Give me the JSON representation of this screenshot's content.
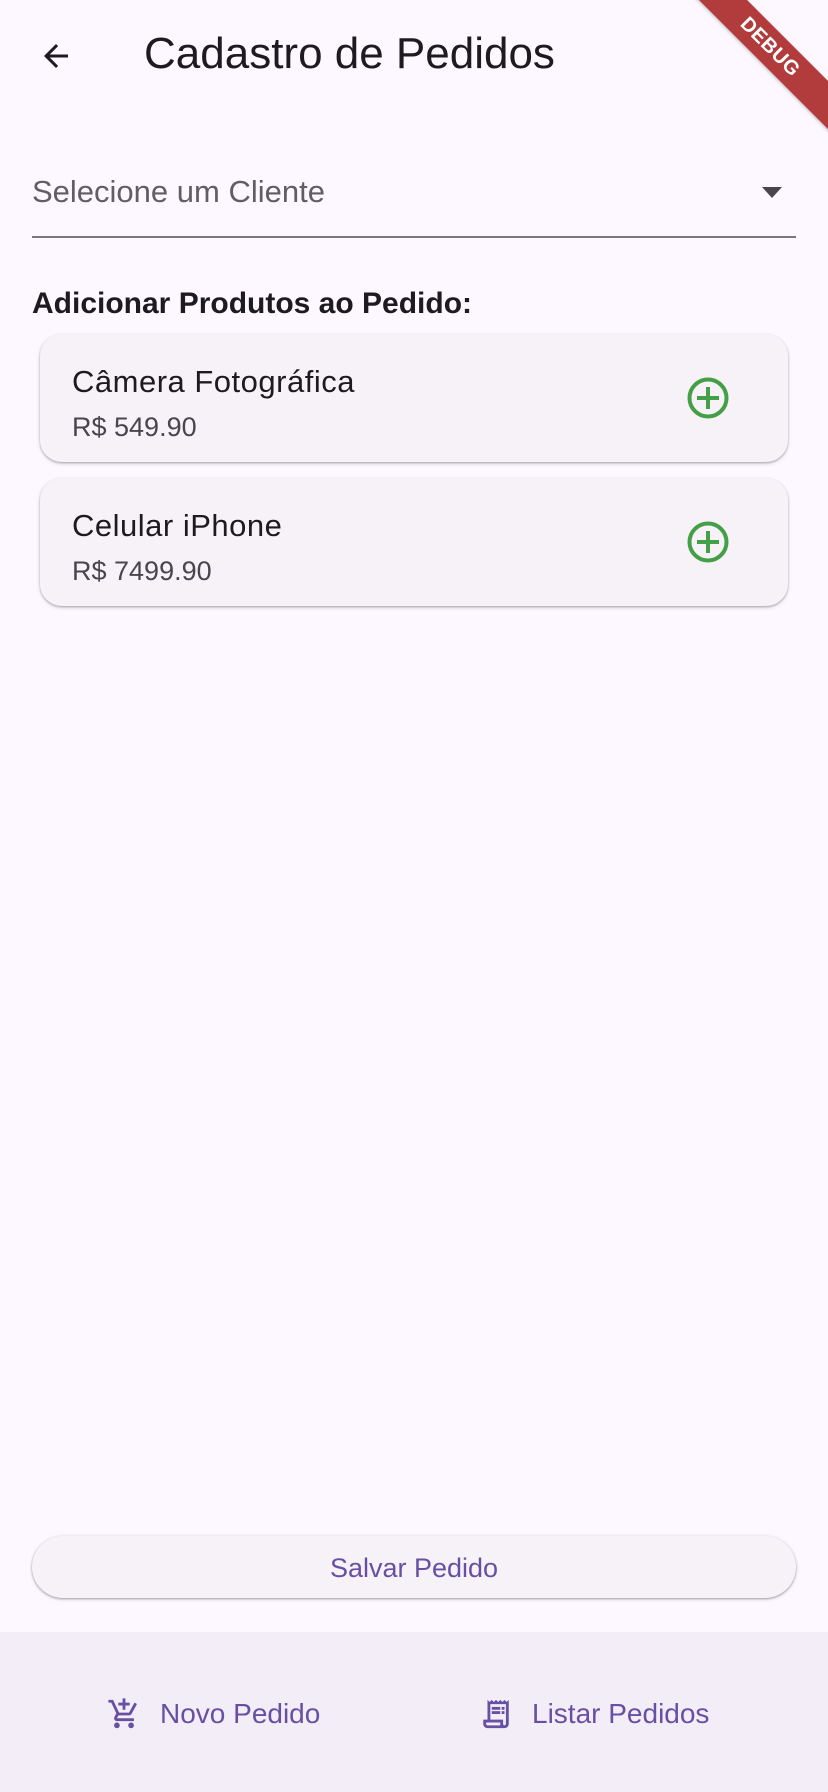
{
  "app_bar": {
    "title": "Cadastro de Pedidos",
    "back_icon": "arrow-back-icon"
  },
  "debug_banner": {
    "label": "DEBUG",
    "color": "#b23b3b"
  },
  "client_select": {
    "placeholder": "Selecione um Cliente",
    "icon": "arrow-drop-down-icon"
  },
  "products_section": {
    "label": "Adicionar Produtos ao Pedido:",
    "items": [
      {
        "name": "Câmera Fotográfica",
        "price": "R$ 549.90",
        "icon": "add-circle-outline-icon"
      },
      {
        "name": "Celular iPhone",
        "price": "R$ 7499.90",
        "icon": "add-circle-outline-icon"
      }
    ]
  },
  "actions": {
    "save_label": "Salvar Pedido"
  },
  "bottom_nav": {
    "items": [
      {
        "label": "Novo Pedido",
        "icon": "add-shopping-cart-icon"
      },
      {
        "label": "Listar Pedidos",
        "icon": "receipt-long-icon"
      }
    ]
  },
  "colors": {
    "background": "#fdf7ff",
    "primary": "#6750a4",
    "add_icon": "#43a047",
    "card_surface": "#f6f2f7",
    "nav_surface": "#f3edf7"
  }
}
